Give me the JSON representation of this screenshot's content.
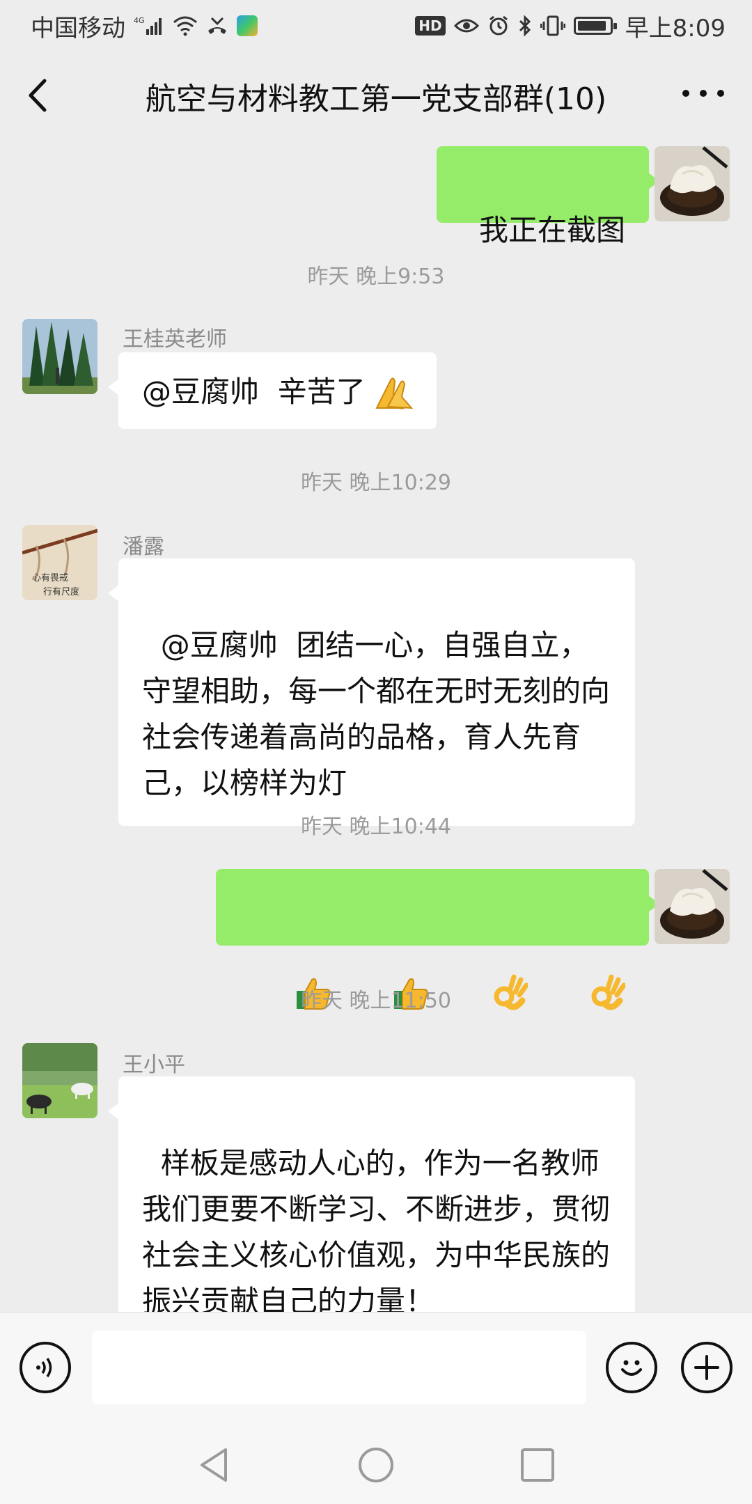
{
  "status_bar": {
    "carrier": "中国移动",
    "network": "4G",
    "hd_badge": "HD",
    "time": "早上8:09"
  },
  "header": {
    "title": "航空与材料教工第一党支部群(10)",
    "back_icon": "chevron-left-icon",
    "more_icon": "more-dots-icon"
  },
  "messages": [
    {
      "type": "outgoing",
      "text": "我正在截图"
    },
    {
      "type": "timestamp",
      "text": "昨天 晚上9:53"
    },
    {
      "type": "incoming",
      "sender": "王桂英老师",
      "text": "@豆腐帅  辛苦了",
      "emoji": [
        "folded-hands-emoji"
      ]
    },
    {
      "type": "timestamp",
      "text": "昨天 晚上10:29"
    },
    {
      "type": "incoming",
      "sender": "潘露",
      "text": "@豆腐帅  团结一心，自强自立，守望相助，每一个都在无时无刻的向社会传递着高尚的品格，育人先育己，以榜样为灯"
    },
    {
      "type": "timestamp",
      "text": "昨天 晚上10:44"
    },
    {
      "type": "outgoing",
      "emoji": [
        "thumbs-up-emoji",
        "thumbs-up-emoji",
        "ok-hand-emoji",
        "ok-hand-emoji"
      ]
    },
    {
      "type": "timestamp",
      "text": "昨天 晚上11:50"
    },
    {
      "type": "incoming",
      "sender": "王小平",
      "text": "样板是感动人心的，作为一名教师我们更要不断学习、不断进步，贯彻社会主义核心价值观，为中华民族的振兴贡献自己的力量！"
    }
  ],
  "input_bar": {
    "voice_icon": "voice-icon",
    "text_value": "",
    "emoji_icon": "smiley-icon",
    "plus_icon": "plus-icon"
  },
  "colors": {
    "background": "#ededed",
    "outgoing_bubble": "#95ec69",
    "incoming_bubble": "#ffffff",
    "timestamp_text": "#9b9b9b"
  }
}
